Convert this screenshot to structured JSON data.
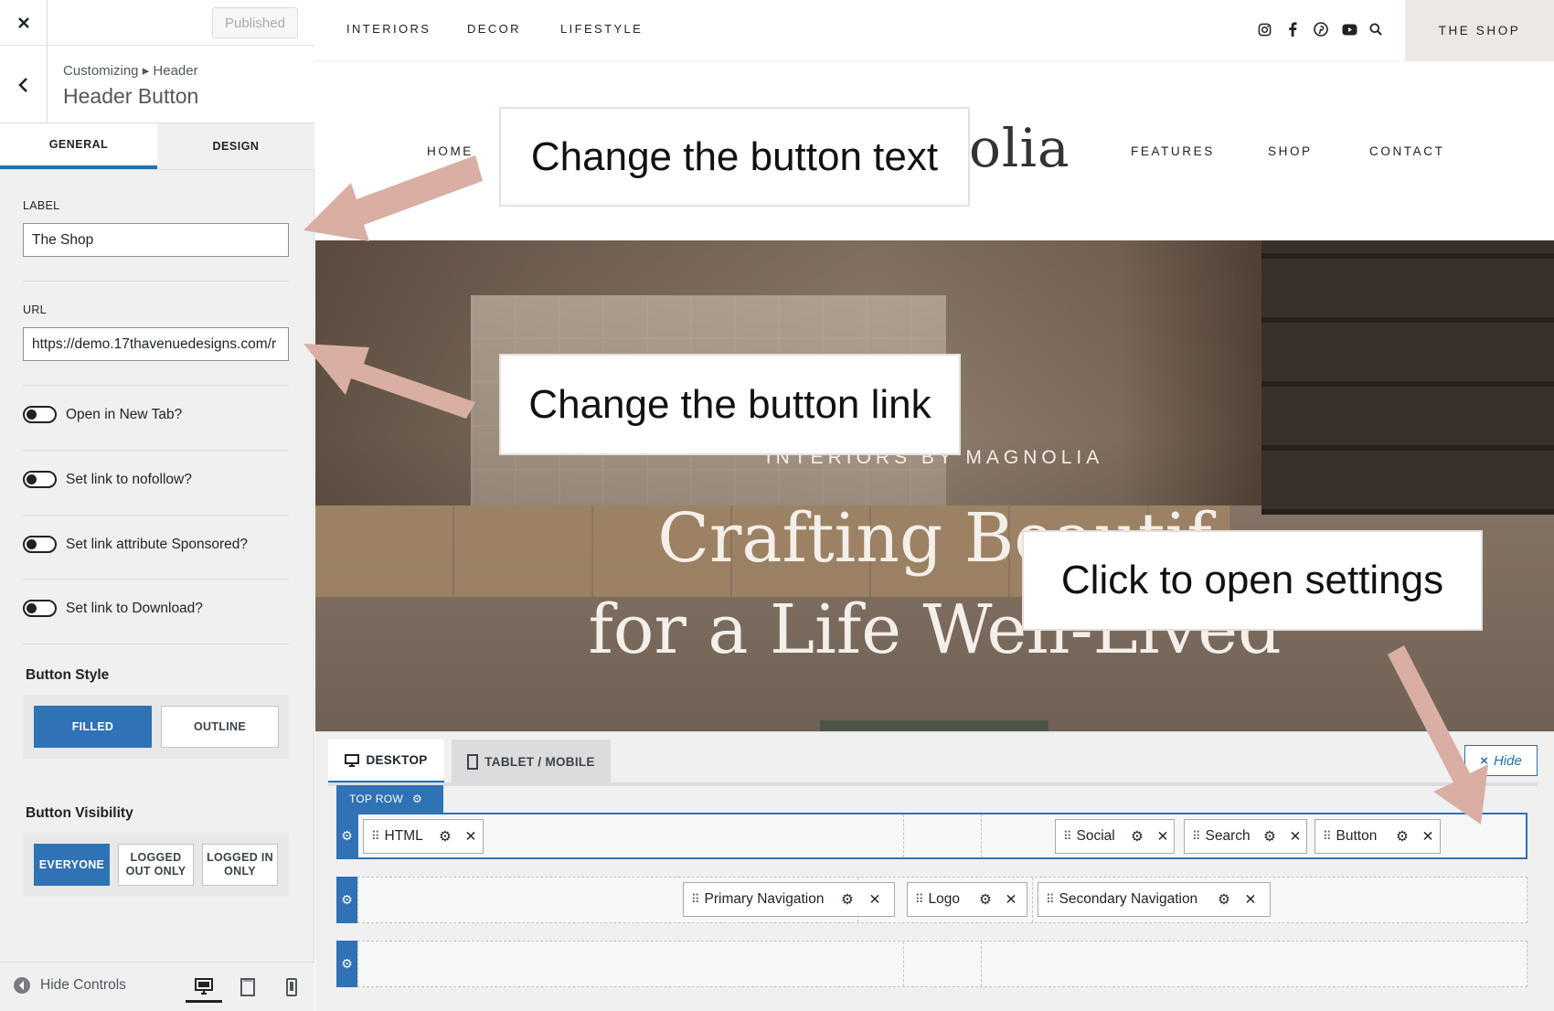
{
  "panel": {
    "close_icon": "close-icon",
    "published_label": "Published",
    "breadcrumb": "Customizing ▸ Header",
    "title": "Header Button",
    "tabs": [
      "GENERAL",
      "DESIGN"
    ],
    "label_field": {
      "label": "LABEL",
      "value": "The Shop"
    },
    "url_field": {
      "label": "URL",
      "value": "https://demo.17thavenuedesigns.com/r"
    },
    "toggles": [
      "Open in New Tab?",
      "Set link to nofollow?",
      "Set link attribute Sponsored?",
      "Set link to Download?"
    ],
    "button_style": {
      "title": "Button Style",
      "options": [
        "FILLED",
        "OUTLINE"
      ],
      "selected": "FILLED"
    },
    "button_visibility": {
      "title": "Button Visibility",
      "options": [
        "EVERYONE",
        "LOGGED OUT ONLY",
        "LOGGED IN ONLY"
      ],
      "selected": "EVERYONE"
    },
    "footer": {
      "hide_controls": "Hide Controls"
    }
  },
  "site": {
    "top_nav": [
      "INTERIORS",
      "DECOR",
      "LIFESTYLE"
    ],
    "social_icons": [
      "instagram-icon",
      "facebook-icon",
      "pinterest-icon",
      "youtube-icon",
      "search-icon"
    ],
    "shop_button": "THE SHOP",
    "main_nav_left": "HOME",
    "logo_fragment": "olia",
    "main_nav_right": [
      "FEATURES",
      "SHOP",
      "CONTACT"
    ],
    "hero_subtitle": "INTERIORS BY MAGNOLIA",
    "hero_line1": "Crafting Beautif",
    "hero_line2": "for a Life Well-Lived"
  },
  "builder": {
    "tabs": [
      "DESKTOP",
      "TABLET / MOBILE"
    ],
    "hide_label": "Hide",
    "top_row_label": "TOP ROW",
    "top_row_items": [
      "HTML",
      "Social",
      "Search",
      "Button"
    ],
    "main_row_items": [
      "Primary Navigation",
      "Logo",
      "Secondary Navigation"
    ]
  },
  "annotations": {
    "text": "Change the button text",
    "link": "Change the button link",
    "settings": "Click to open settings",
    "arrow_color": "#d9aea3"
  },
  "colors": {
    "accent": "#2f72b5",
    "shop_bg": "#ede8e4"
  }
}
